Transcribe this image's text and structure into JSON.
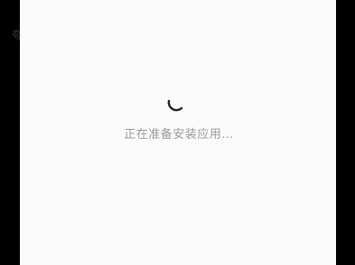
{
  "loading": {
    "status_text": "正在准备安装应用…",
    "progress_state": "indeterminate"
  },
  "left_edge": {
    "partial_glyph": "夸"
  },
  "colors": {
    "background": "#fafafa",
    "frame": "#000000",
    "spinner": "#222222",
    "status_text": "#9a9a9a"
  },
  "icons": {
    "spinner": "loading-spinner-icon"
  }
}
